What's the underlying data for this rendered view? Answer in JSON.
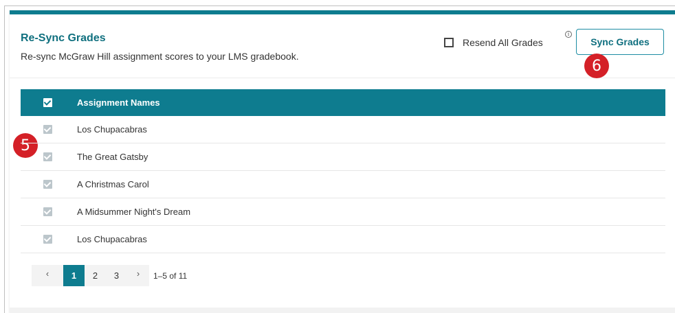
{
  "header": {
    "title": "Re-Sync Grades",
    "subtitle": "Re-sync McGraw Hill assignment scores to your LMS gradebook.",
    "resend_label": "Resend All Grades",
    "info_icon": "i",
    "sync_button": "Sync Grades"
  },
  "markers": {
    "marker_5": "5",
    "marker_6": "6"
  },
  "table": {
    "column_header": "Assignment Names",
    "rows": [
      {
        "name": "Los Chupacabras",
        "checked": true
      },
      {
        "name": "The Great Gatsby",
        "checked": true
      },
      {
        "name": "A Christmas Carol",
        "checked": true
      },
      {
        "name": "A Midsummer Night's Dream",
        "checked": true
      },
      {
        "name": "Los Chupacabras",
        "checked": true
      }
    ]
  },
  "pagination": {
    "prev": "‹",
    "pages": [
      "1",
      "2",
      "3"
    ],
    "current_page": "1",
    "next": "›",
    "range": "1–5 of 11"
  },
  "colors": {
    "accent": "#0e7c8f",
    "title": "#10707f",
    "marker": "#d42027"
  }
}
